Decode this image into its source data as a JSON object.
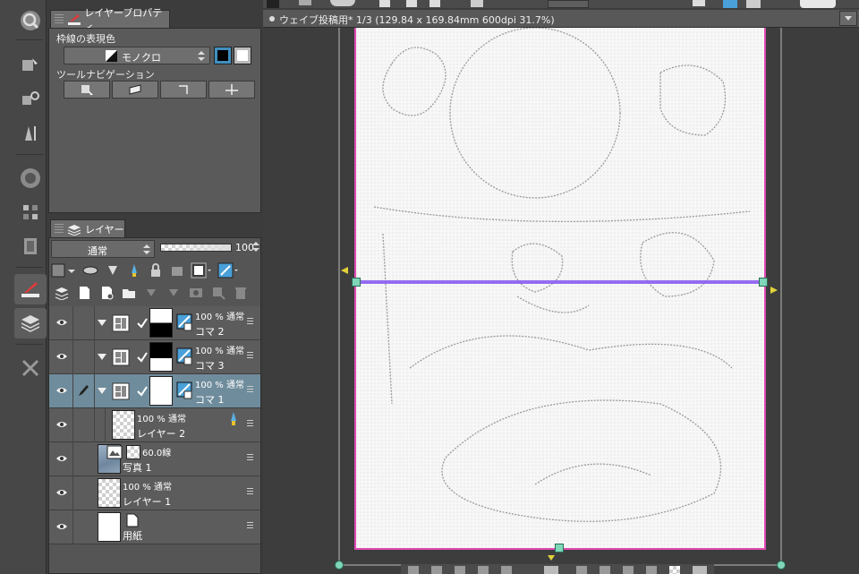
{
  "property_panel": {
    "tab_title": "レイヤープロパティ",
    "border_color_label": "枠線の表現色",
    "color_mode_value": "モノクロ",
    "tool_nav_label": "ツールナビゲーション"
  },
  "layer_panel": {
    "tab_title": "レイヤー",
    "blend_mode": "通常",
    "opacity_value": "100",
    "layers": [
      {
        "top": "100 % 通常",
        "bottom": "コマ 2",
        "type": "frame"
      },
      {
        "top": "100 % 通常",
        "bottom": "コマ 3",
        "type": "frame"
      },
      {
        "top": "100 % 通常",
        "bottom": "コマ 1",
        "type": "frame",
        "selected": true
      },
      {
        "top": "100 % 通常",
        "bottom": "レイヤー 2",
        "type": "raster"
      },
      {
        "top": "60.0線",
        "bottom": "写真 1",
        "type": "photo"
      },
      {
        "top": "100 % 通常",
        "bottom": "レイヤー 1",
        "type": "raster"
      },
      {
        "top": "",
        "bottom": "用紙",
        "type": "paper"
      }
    ]
  },
  "document": {
    "tab_title": "ウェイブ投稿用* 1/3 (129.84 x 169.84mm 600dpi 31.7%)"
  },
  "colors": {
    "accent_selected_row": "#6f8c9c",
    "paper_border": "#e24ab5",
    "guide_line": "#8a5cf0",
    "handle": "#7fd6b8"
  }
}
